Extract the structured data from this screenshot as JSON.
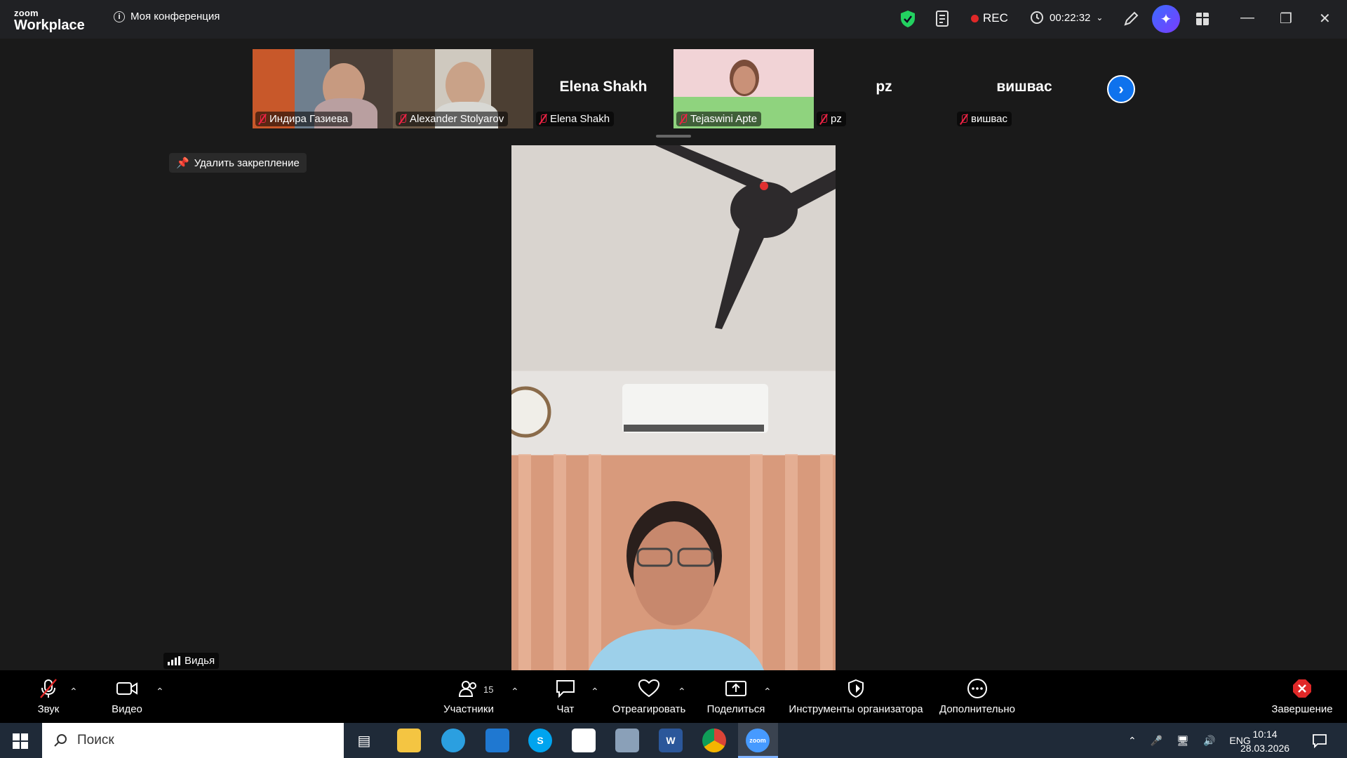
{
  "app": {
    "logo_line1": "zoom",
    "logo_line2": "Workplace",
    "meeting_title": "Моя конференция",
    "rec_label": "REC",
    "timer": "00:22:32",
    "accent_color": "#0e72ed",
    "rec_color": "#e02828"
  },
  "participants": [
    {
      "name": "Индира Газиева",
      "video": true
    },
    {
      "name": "Alexander Stolyarov",
      "video": true
    },
    {
      "name": "Elena Shakh",
      "video": false,
      "display": "Elena Shakh"
    },
    {
      "name": "Tejaswini Apte",
      "video": true
    },
    {
      "name": "pz",
      "video": false,
      "display": "pz"
    },
    {
      "name": "вишвас",
      "video": false,
      "display": "вишвас"
    }
  ],
  "stage": {
    "unpin_label": "Удалить закрепление",
    "active_speaker": "Видья"
  },
  "toolbar": {
    "audio": "Звук",
    "video": "Видео",
    "participants": "Участники",
    "participants_count": "15",
    "chat": "Чат",
    "react": "Отреагировать",
    "share": "Поделиться",
    "host_tools": "Инструменты организатора",
    "more": "Дополнительно",
    "end": "Завершение"
  },
  "taskbar": {
    "search_placeholder": "Поиск",
    "lang": "ENG",
    "time": "10:14",
    "date": "28.03.2026"
  }
}
